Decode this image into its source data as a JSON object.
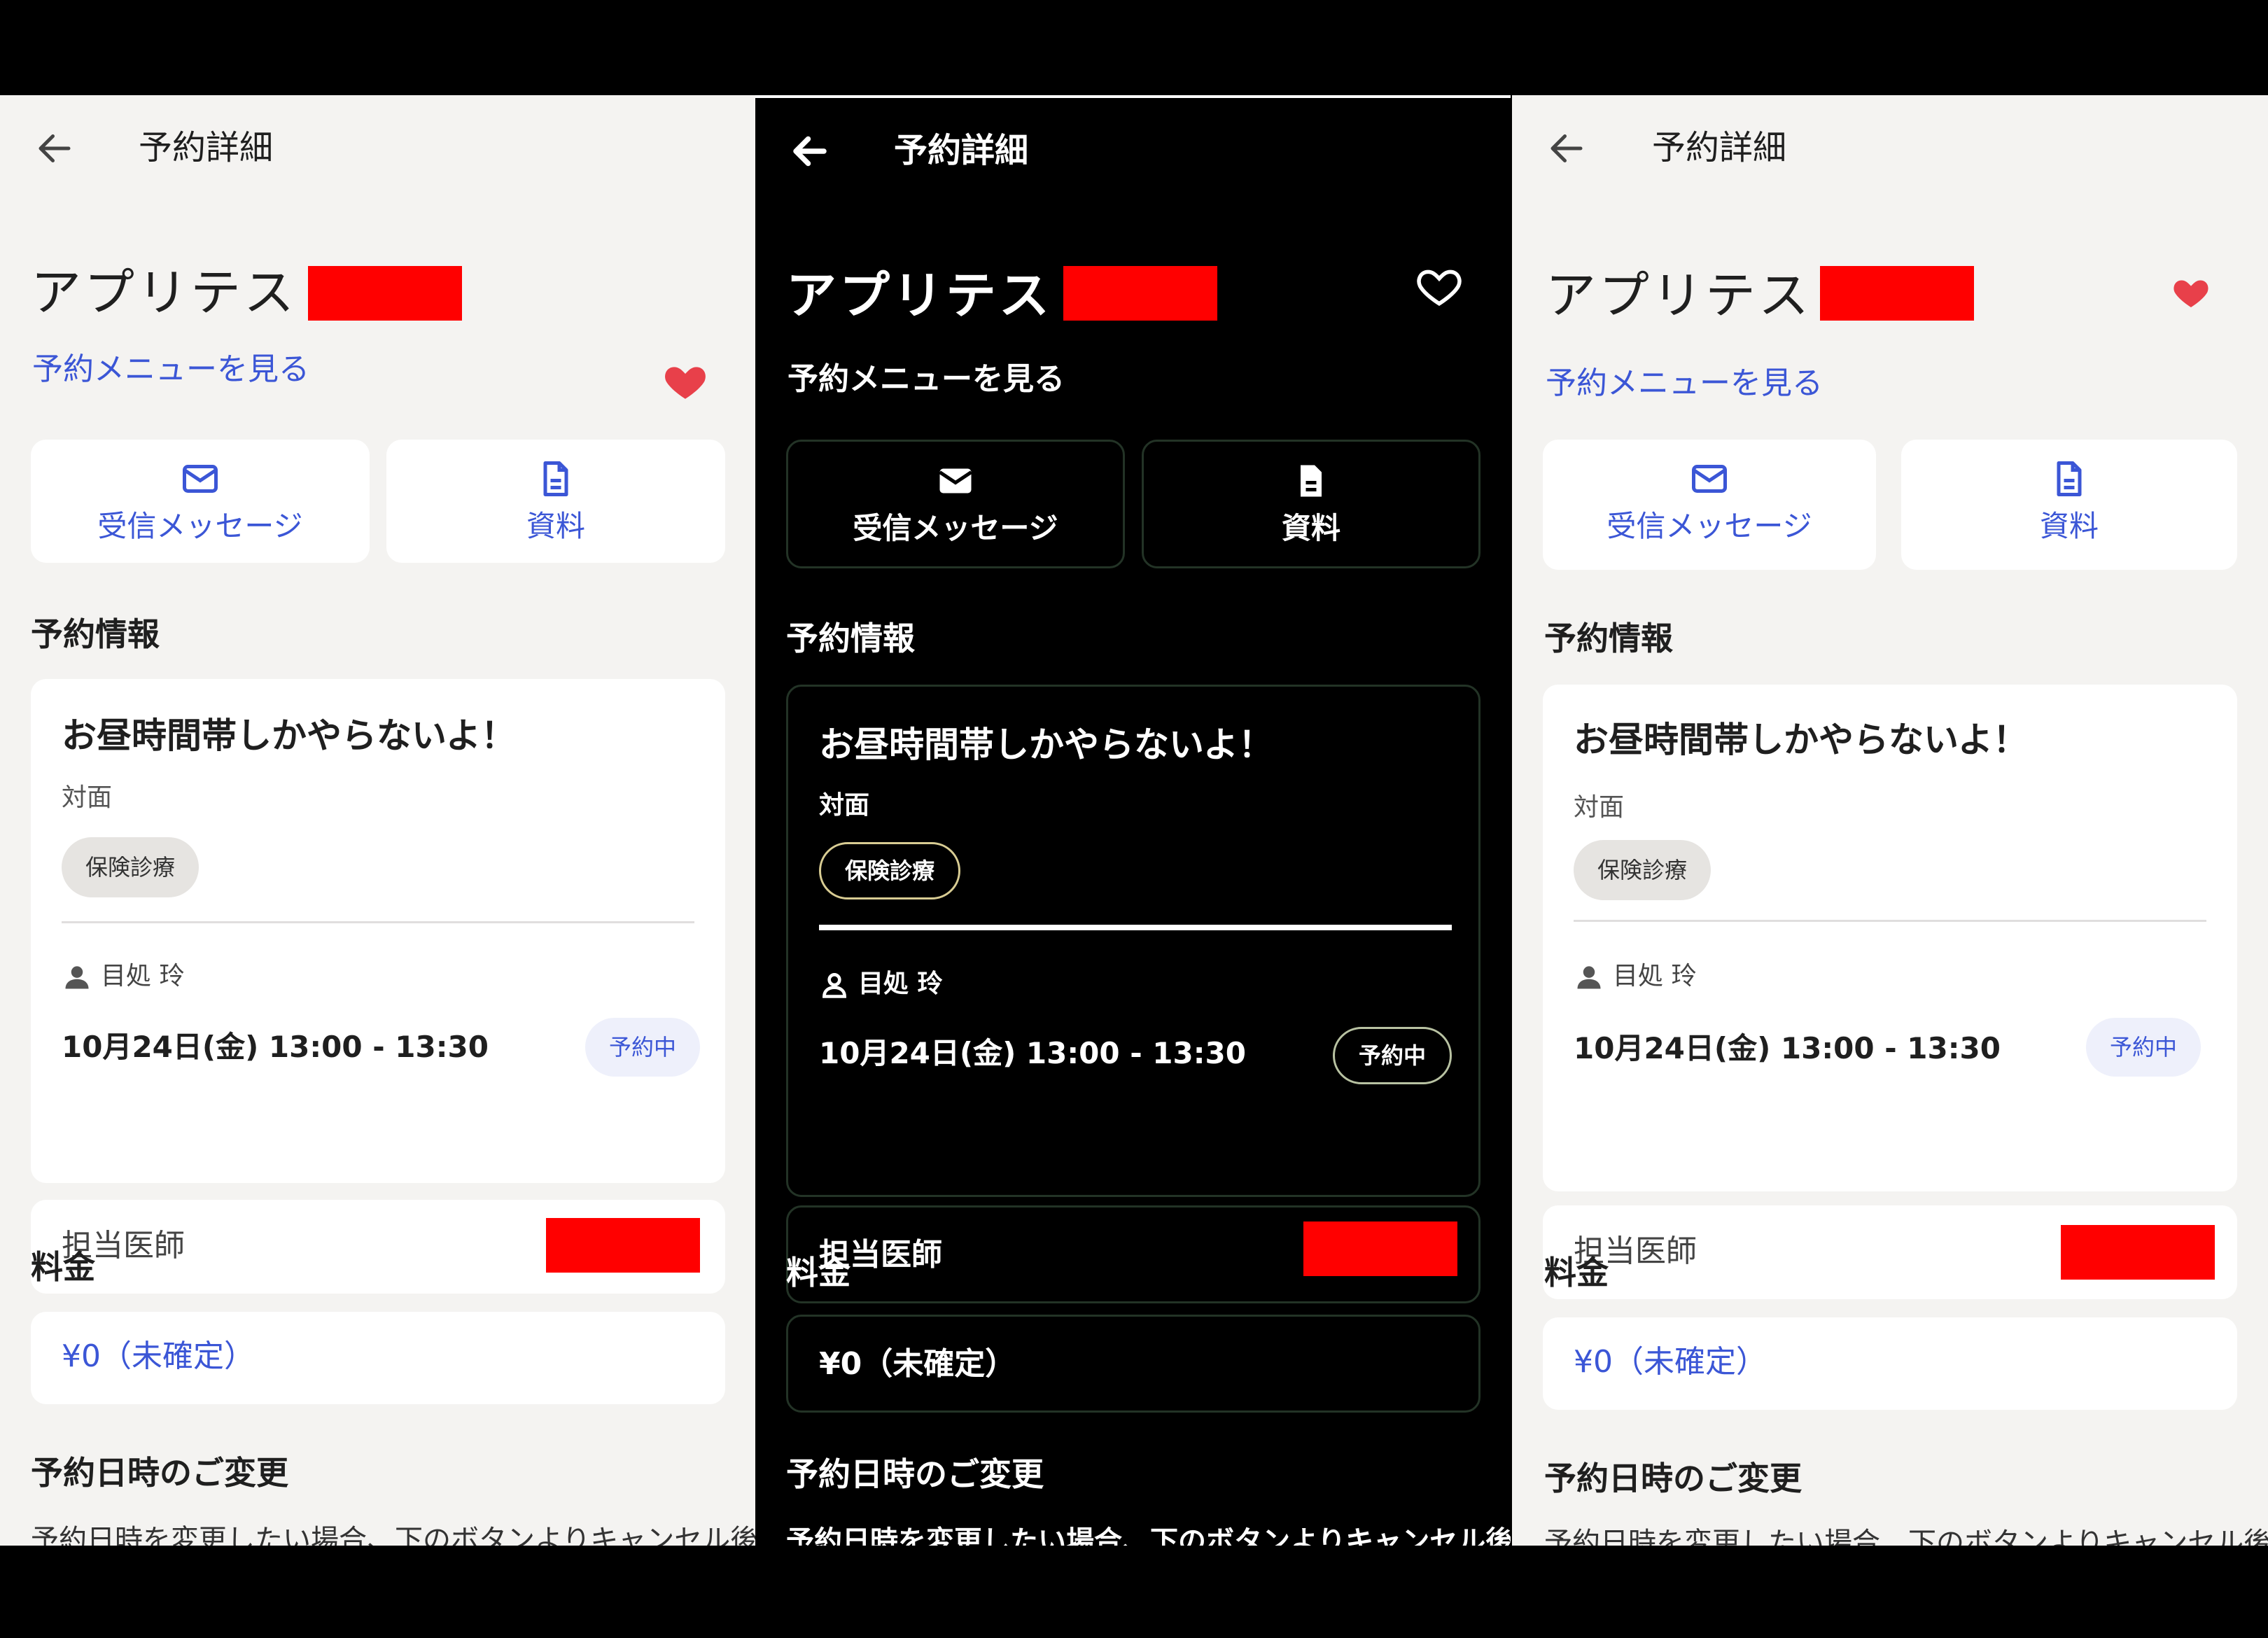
{
  "header": {
    "title": "予約詳細"
  },
  "shop": {
    "name": "アプリテスト"
  },
  "menu_link": "予約メニューを見る",
  "actions": {
    "messages": "受信メッセージ",
    "documents": "資料"
  },
  "reservation": {
    "section_title": "予約情報",
    "title": "お昼時間帯しかやらないよ！",
    "type": "対面",
    "tag": "保険診療",
    "patient": "目処 玲",
    "datetime": "10月24日(金) 13:00 - 13:30",
    "status": "予約中"
  },
  "doctor": {
    "label": "担当医師"
  },
  "fee": {
    "section_title": "料金",
    "value": "¥0（未確定）"
  },
  "change": {
    "section_title": "予約日時のご変更",
    "text": "予約日時を変更したい場合、下のボタンよりキャンセル後、本"
  },
  "colors": {
    "accent": "#3b56d6",
    "favorite": "#e8404a",
    "redaction": "#ff0000",
    "background": "#f4f3f1"
  }
}
